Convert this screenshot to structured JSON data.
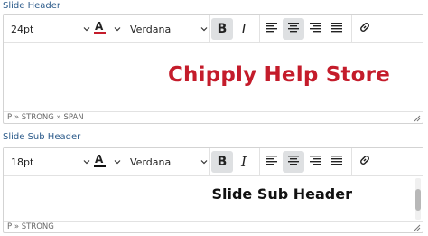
{
  "editors": [
    {
      "label": "Slide Header",
      "font_size": "24pt",
      "font_family": "Verdana",
      "content_text": "Chipply Help Store",
      "status_path": "P » STRONG » SPAN",
      "text_color": "#c41c2b",
      "active_tools": [
        "bold",
        "align-center"
      ]
    },
    {
      "label": "Slide Sub Header",
      "font_size": "18pt",
      "font_family": "Verdana",
      "content_text": "Slide Sub Header",
      "status_path": "P » STRONG",
      "text_color": "#111111",
      "active_tools": [
        "bold",
        "align-center"
      ]
    }
  ],
  "icons": {
    "bold_glyph": "B",
    "italic_glyph": "I"
  },
  "colors": {
    "label": "#2b5a8a",
    "active_button": "#dee0e2",
    "header_text_color": "#c41c2b",
    "border": "#d3d3d3"
  }
}
